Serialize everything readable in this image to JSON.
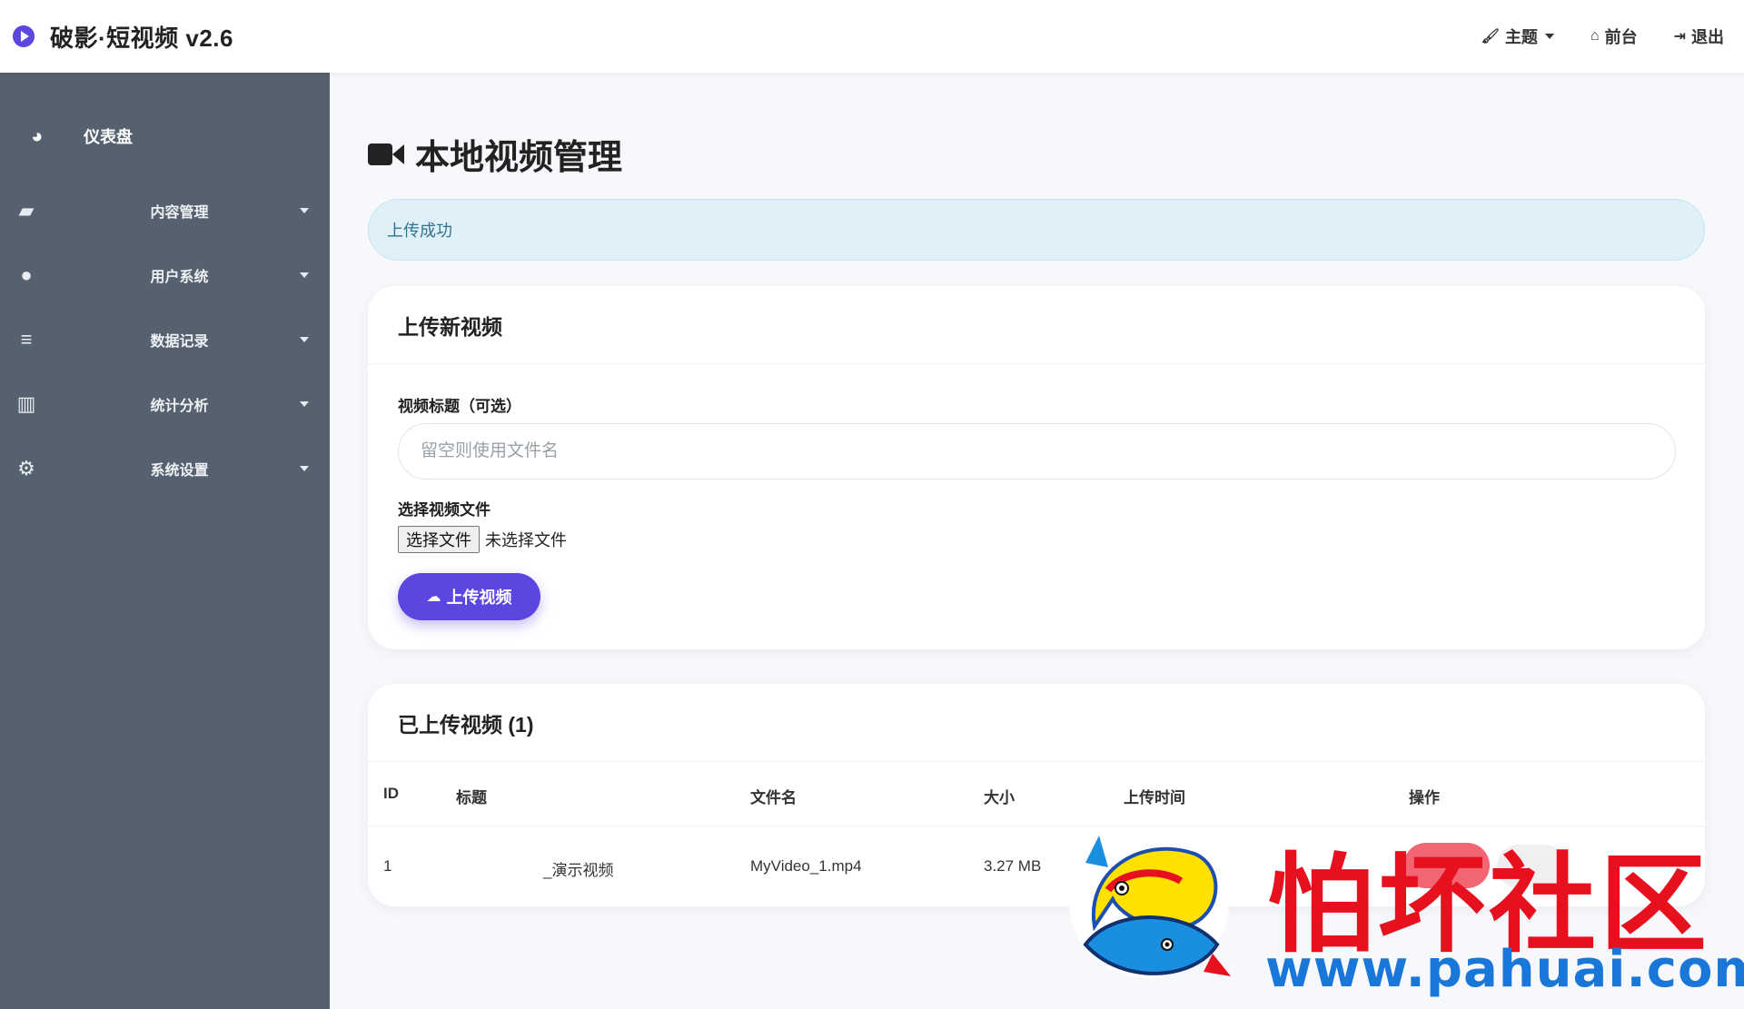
{
  "app": {
    "title": "破影·短视频 v2.6",
    "accent_color": "#5b47e0",
    "sidebar_color": "#56616f"
  },
  "topnav": {
    "theme_label": "主题",
    "frontend_label": "前台",
    "logout_label": "退出"
  },
  "sidebar": {
    "dashboard_label": "仪表盘",
    "items": [
      {
        "label": "内容管理",
        "icon": "folder-open-icon"
      },
      {
        "label": "用户系统",
        "icon": "users-icon"
      },
      {
        "label": "数据记录",
        "icon": "database-icon"
      },
      {
        "label": "统计分析",
        "icon": "bar-chart-icon"
      },
      {
        "label": "系统设置",
        "icon": "gears-icon"
      }
    ]
  },
  "page": {
    "title": "本地视频管理",
    "alert": "上传成功"
  },
  "upload_card": {
    "header": "上传新视频",
    "title_label": "视频标题（可选）",
    "title_placeholder": "留空则使用文件名",
    "file_label": "选择视频文件",
    "file_button": "选择文件",
    "file_status": "未选择文件",
    "submit_label": "上传视频"
  },
  "list_card": {
    "header": "已上传视频 (1)",
    "columns": [
      "ID",
      "标题",
      "文件名",
      "大小",
      "上传时间",
      "操作"
    ],
    "rows": [
      {
        "id": "1",
        "title": "_演示视频",
        "filename": "MyVideo_1.mp4",
        "size": "3.27 MB"
      }
    ]
  },
  "watermark": {
    "text_cn": "怕坏社区",
    "url": "www.pahuai.com"
  }
}
